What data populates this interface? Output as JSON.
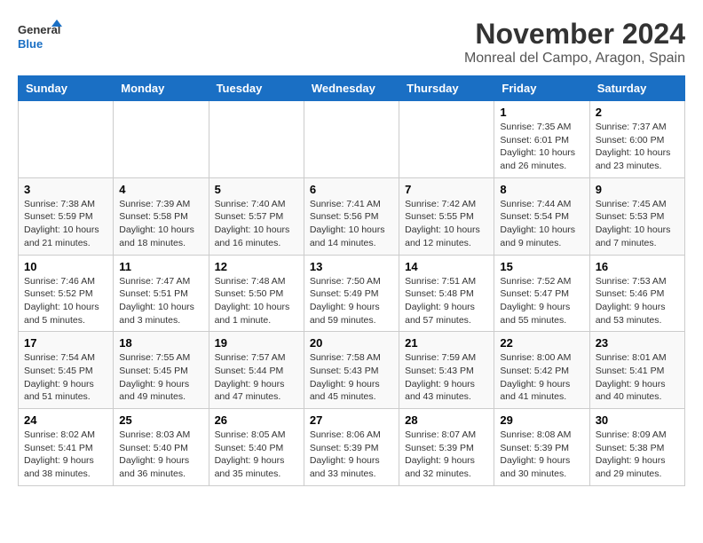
{
  "header": {
    "logo": {
      "line1": "General",
      "line2": "Blue"
    },
    "title": "November 2024",
    "location": "Monreal del Campo, Aragon, Spain"
  },
  "days_of_week": [
    "Sunday",
    "Monday",
    "Tuesday",
    "Wednesday",
    "Thursday",
    "Friday",
    "Saturday"
  ],
  "weeks": [
    {
      "days": [
        {
          "number": "",
          "info": ""
        },
        {
          "number": "",
          "info": ""
        },
        {
          "number": "",
          "info": ""
        },
        {
          "number": "",
          "info": ""
        },
        {
          "number": "",
          "info": ""
        },
        {
          "number": "1",
          "info": "Sunrise: 7:35 AM\nSunset: 6:01 PM\nDaylight: 10 hours and 26 minutes."
        },
        {
          "number": "2",
          "info": "Sunrise: 7:37 AM\nSunset: 6:00 PM\nDaylight: 10 hours and 23 minutes."
        }
      ]
    },
    {
      "days": [
        {
          "number": "3",
          "info": "Sunrise: 7:38 AM\nSunset: 5:59 PM\nDaylight: 10 hours and 21 minutes."
        },
        {
          "number": "4",
          "info": "Sunrise: 7:39 AM\nSunset: 5:58 PM\nDaylight: 10 hours and 18 minutes."
        },
        {
          "number": "5",
          "info": "Sunrise: 7:40 AM\nSunset: 5:57 PM\nDaylight: 10 hours and 16 minutes."
        },
        {
          "number": "6",
          "info": "Sunrise: 7:41 AM\nSunset: 5:56 PM\nDaylight: 10 hours and 14 minutes."
        },
        {
          "number": "7",
          "info": "Sunrise: 7:42 AM\nSunset: 5:55 PM\nDaylight: 10 hours and 12 minutes."
        },
        {
          "number": "8",
          "info": "Sunrise: 7:44 AM\nSunset: 5:54 PM\nDaylight: 10 hours and 9 minutes."
        },
        {
          "number": "9",
          "info": "Sunrise: 7:45 AM\nSunset: 5:53 PM\nDaylight: 10 hours and 7 minutes."
        }
      ]
    },
    {
      "days": [
        {
          "number": "10",
          "info": "Sunrise: 7:46 AM\nSunset: 5:52 PM\nDaylight: 10 hours and 5 minutes."
        },
        {
          "number": "11",
          "info": "Sunrise: 7:47 AM\nSunset: 5:51 PM\nDaylight: 10 hours and 3 minutes."
        },
        {
          "number": "12",
          "info": "Sunrise: 7:48 AM\nSunset: 5:50 PM\nDaylight: 10 hours and 1 minute."
        },
        {
          "number": "13",
          "info": "Sunrise: 7:50 AM\nSunset: 5:49 PM\nDaylight: 9 hours and 59 minutes."
        },
        {
          "number": "14",
          "info": "Sunrise: 7:51 AM\nSunset: 5:48 PM\nDaylight: 9 hours and 57 minutes."
        },
        {
          "number": "15",
          "info": "Sunrise: 7:52 AM\nSunset: 5:47 PM\nDaylight: 9 hours and 55 minutes."
        },
        {
          "number": "16",
          "info": "Sunrise: 7:53 AM\nSunset: 5:46 PM\nDaylight: 9 hours and 53 minutes."
        }
      ]
    },
    {
      "days": [
        {
          "number": "17",
          "info": "Sunrise: 7:54 AM\nSunset: 5:45 PM\nDaylight: 9 hours and 51 minutes."
        },
        {
          "number": "18",
          "info": "Sunrise: 7:55 AM\nSunset: 5:45 PM\nDaylight: 9 hours and 49 minutes."
        },
        {
          "number": "19",
          "info": "Sunrise: 7:57 AM\nSunset: 5:44 PM\nDaylight: 9 hours and 47 minutes."
        },
        {
          "number": "20",
          "info": "Sunrise: 7:58 AM\nSunset: 5:43 PM\nDaylight: 9 hours and 45 minutes."
        },
        {
          "number": "21",
          "info": "Sunrise: 7:59 AM\nSunset: 5:43 PM\nDaylight: 9 hours and 43 minutes."
        },
        {
          "number": "22",
          "info": "Sunrise: 8:00 AM\nSunset: 5:42 PM\nDaylight: 9 hours and 41 minutes."
        },
        {
          "number": "23",
          "info": "Sunrise: 8:01 AM\nSunset: 5:41 PM\nDaylight: 9 hours and 40 minutes."
        }
      ]
    },
    {
      "days": [
        {
          "number": "24",
          "info": "Sunrise: 8:02 AM\nSunset: 5:41 PM\nDaylight: 9 hours and 38 minutes."
        },
        {
          "number": "25",
          "info": "Sunrise: 8:03 AM\nSunset: 5:40 PM\nDaylight: 9 hours and 36 minutes."
        },
        {
          "number": "26",
          "info": "Sunrise: 8:05 AM\nSunset: 5:40 PM\nDaylight: 9 hours and 35 minutes."
        },
        {
          "number": "27",
          "info": "Sunrise: 8:06 AM\nSunset: 5:39 PM\nDaylight: 9 hours and 33 minutes."
        },
        {
          "number": "28",
          "info": "Sunrise: 8:07 AM\nSunset: 5:39 PM\nDaylight: 9 hours and 32 minutes."
        },
        {
          "number": "29",
          "info": "Sunrise: 8:08 AM\nSunset: 5:39 PM\nDaylight: 9 hours and 30 minutes."
        },
        {
          "number": "30",
          "info": "Sunrise: 8:09 AM\nSunset: 5:38 PM\nDaylight: 9 hours and 29 minutes."
        }
      ]
    }
  ]
}
